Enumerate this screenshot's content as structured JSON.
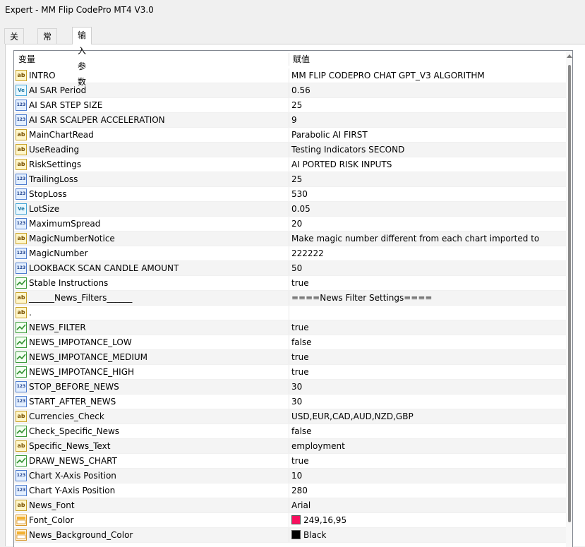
{
  "window": {
    "title": "Expert - MM Flip CodePro MT4 V3.0"
  },
  "tabs": [
    {
      "label": "关于"
    },
    {
      "label": "常用"
    },
    {
      "label": "输入参数"
    }
  ],
  "table": {
    "headers": {
      "variable": "变量",
      "value": "赋值"
    },
    "rows": [
      {
        "icon": "string-icon",
        "name": "INTRO",
        "value": "MM FLIP CODEPRO CHAT GPT_V3 ALGORITHM"
      },
      {
        "icon": "double-icon",
        "name": "AI SAR Period",
        "value": "0.56"
      },
      {
        "icon": "integer-icon",
        "name": "AI SAR STEP SIZE",
        "value": "25"
      },
      {
        "icon": "integer-icon",
        "name": "AI SAR SCALPER ACCELERATION",
        "value": "9"
      },
      {
        "icon": "string-icon",
        "name": "MainChartRead",
        "value": "Parabolic AI FIRST"
      },
      {
        "icon": "string-icon",
        "name": "UseReading",
        "value": "Testing Indicators SECOND"
      },
      {
        "icon": "string-icon",
        "name": "RiskSettings",
        "value": "AI PORTED RISK INPUTS"
      },
      {
        "icon": "integer-icon",
        "name": "TrailingLoss",
        "value": "25"
      },
      {
        "icon": "integer-icon",
        "name": "StopLoss",
        "value": "530"
      },
      {
        "icon": "double-icon",
        "name": "LotSize",
        "value": "0.05"
      },
      {
        "icon": "integer-icon",
        "name": "MaximumSpread",
        "value": "20"
      },
      {
        "icon": "string-icon",
        "name": "MagicNumberNotice",
        "value": "Make magic number different from each chart imported to"
      },
      {
        "icon": "integer-icon",
        "name": "MagicNumber",
        "value": "222222"
      },
      {
        "icon": "integer-icon",
        "name": "LOOKBACK SCAN CANDLE AMOUNT",
        "value": "50"
      },
      {
        "icon": "bool-icon",
        "name": "Stable Instructions",
        "value": "true"
      },
      {
        "icon": "string-icon",
        "name": "______News_Filters______",
        "value": "====News Filter Settings===="
      },
      {
        "icon": "string-icon",
        "name": ".",
        "value": ""
      },
      {
        "icon": "bool-icon",
        "name": "NEWS_FILTER",
        "value": "true"
      },
      {
        "icon": "bool-icon",
        "name": "NEWS_IMPOTANCE_LOW",
        "value": "false"
      },
      {
        "icon": "bool-icon",
        "name": "NEWS_IMPOTANCE_MEDIUM",
        "value": "true"
      },
      {
        "icon": "bool-icon",
        "name": "NEWS_IMPOTANCE_HIGH",
        "value": "true"
      },
      {
        "icon": "integer-icon",
        "name": "STOP_BEFORE_NEWS",
        "value": "30"
      },
      {
        "icon": "integer-icon",
        "name": "START_AFTER_NEWS",
        "value": "30"
      },
      {
        "icon": "string-icon",
        "name": "Currencies_Check",
        "value": "USD,EUR,CAD,AUD,NZD,GBP"
      },
      {
        "icon": "bool-icon",
        "name": "Check_Specific_News",
        "value": "false"
      },
      {
        "icon": "string-icon",
        "name": "Specific_News_Text",
        "value": "employment"
      },
      {
        "icon": "bool-icon",
        "name": "DRAW_NEWS_CHART",
        "value": "true"
      },
      {
        "icon": "integer-icon",
        "name": "Chart X-Axis Position",
        "value": "10"
      },
      {
        "icon": "integer-icon",
        "name": "Chart Y-Axis Position",
        "value": "280"
      },
      {
        "icon": "string-icon",
        "name": "News_Font",
        "value": "Arial"
      },
      {
        "icon": "color-icon",
        "name": "Font_Color",
        "value": "249,16,95",
        "swatch": "#f9105f"
      },
      {
        "icon": "color-icon",
        "name": "News_Background_Color",
        "value": "Black",
        "swatch": "#000000"
      }
    ]
  }
}
